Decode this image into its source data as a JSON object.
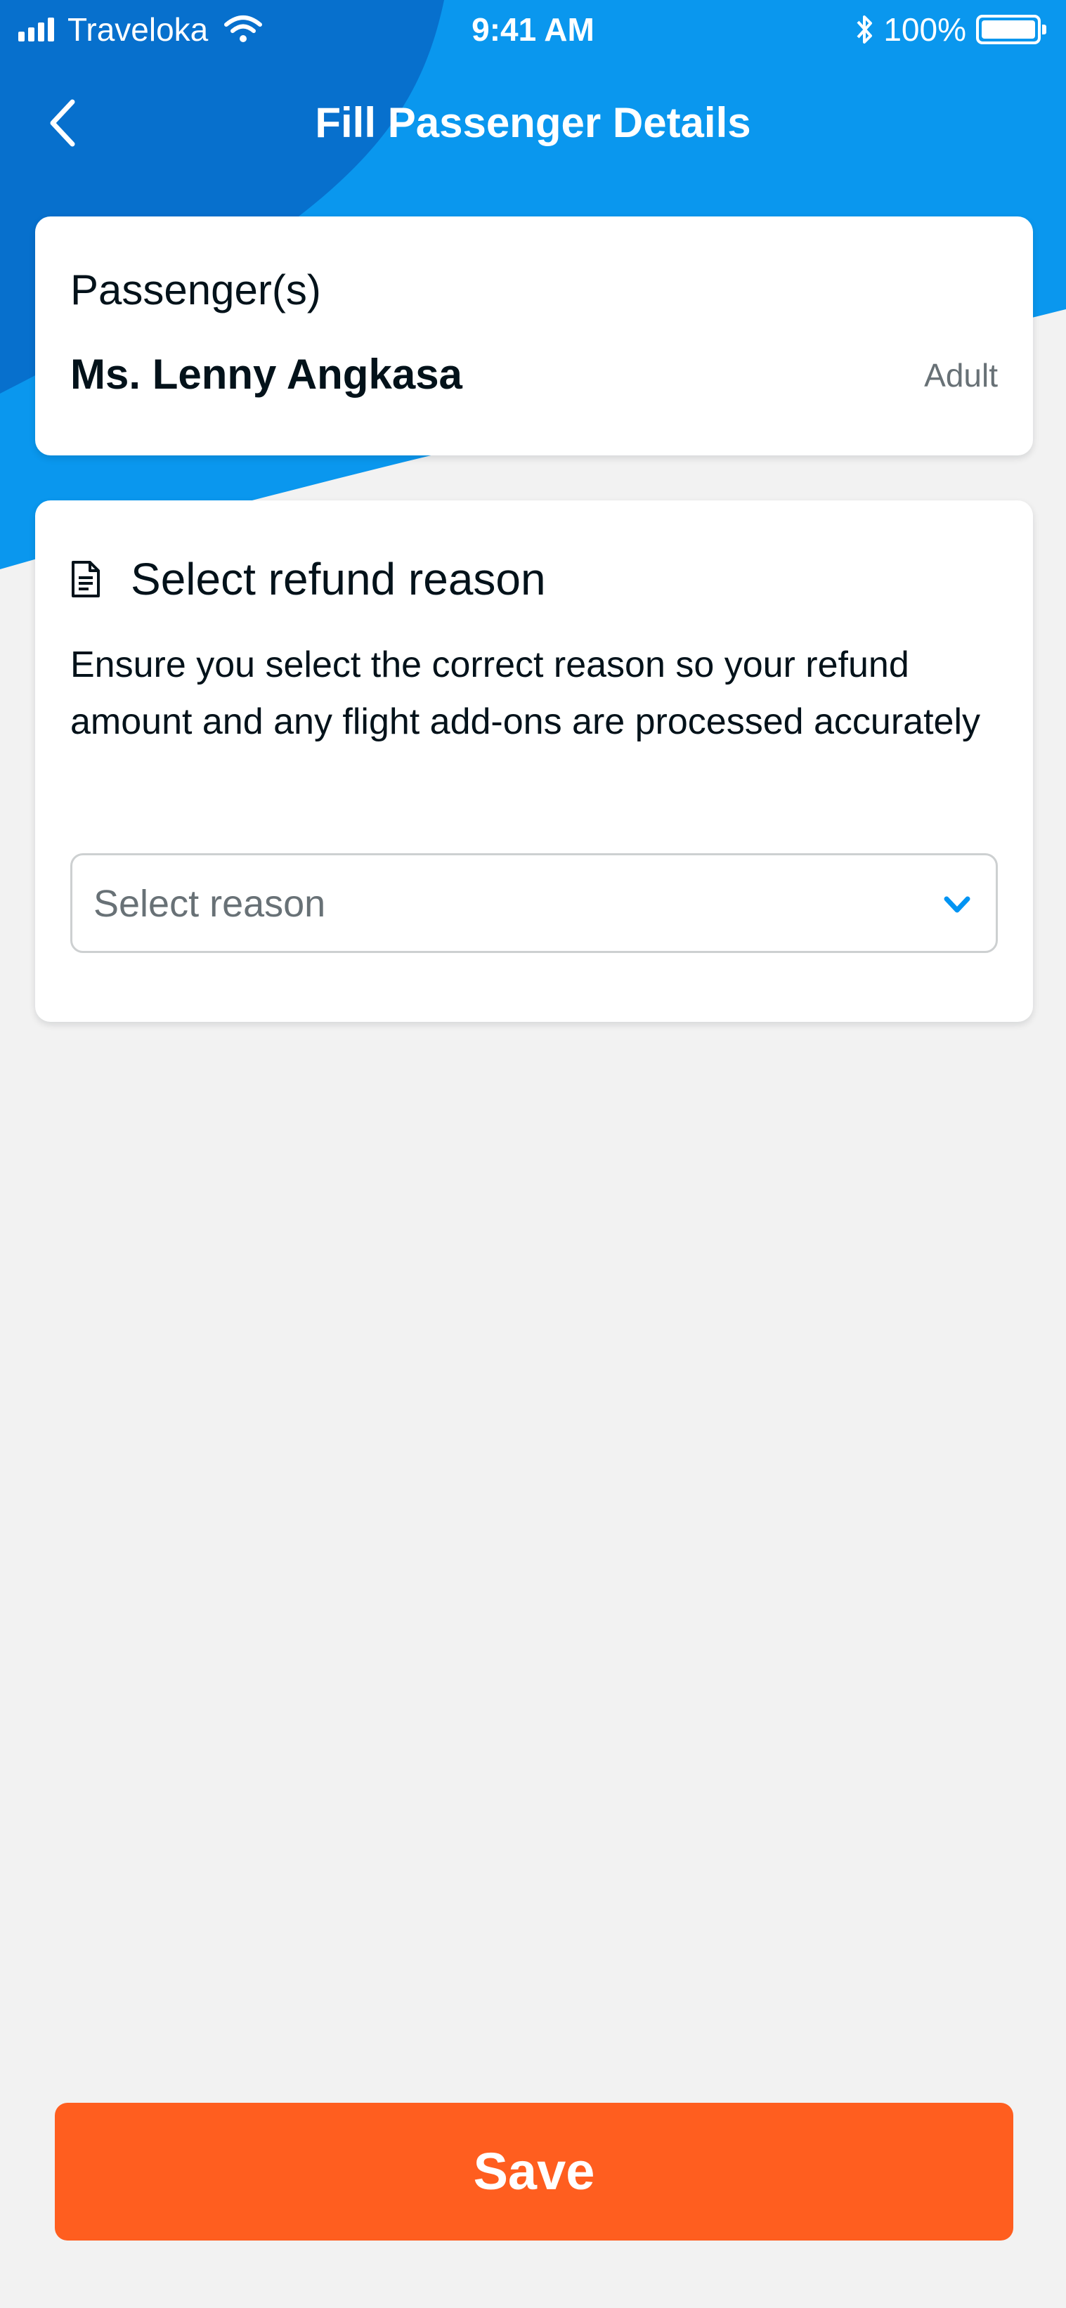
{
  "status_bar": {
    "carrier": "Traveloka",
    "time": "9:41 AM",
    "battery": "100%",
    "icons": [
      "signal-icon",
      "wifi-icon",
      "bluetooth-icon",
      "battery-icon"
    ]
  },
  "header": {
    "title": "Fill Passenger Details",
    "back_icon": "chevron-left-icon"
  },
  "passenger_card": {
    "label": "Passenger(s)",
    "name": "Ms. Lenny Angkasa",
    "type": "Adult"
  },
  "refund_card": {
    "icon": "document-icon",
    "title": "Select refund reason",
    "description": "Ensure you select the correct reason so your refund amount and any flight add-ons are processed accurately",
    "select": {
      "placeholder": "Select reason",
      "value": "",
      "icon": "chevron-down-icon"
    }
  },
  "footer": {
    "save_label": "Save"
  },
  "colors": {
    "header_blue": "#0A97EE",
    "header_dark_blue": "#0770CD",
    "accent_blue": "#0194F3",
    "save_orange": "#FF5E1F",
    "background": "#F2F2F2",
    "text_primary": "#03121A",
    "text_secondary": "#687176"
  }
}
